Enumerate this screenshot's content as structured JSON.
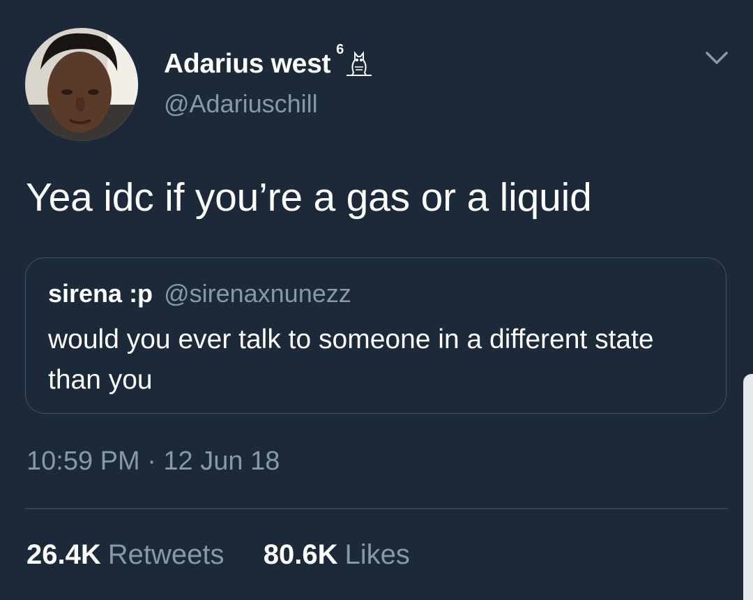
{
  "tweet": {
    "author": {
      "display_name": "Adarius west",
      "name_emoji_number": "6",
      "name_emoji_icon": "owl-icon",
      "handle": "@Adariuschill",
      "avatar_icon": "profile-avatar"
    },
    "menu_icon": "chevron-down-icon",
    "text": "Yea idc if you’re a gas or a liquid",
    "quoted": {
      "display_name": "sirena :p",
      "handle": "@sirenaxnunezz",
      "text": "would you ever talk to someone in a different state than you"
    },
    "timestamp": "10:59 PM · 12 Jun 18",
    "stats": {
      "retweets_count": "26.4K",
      "retweets_label": "Retweets",
      "likes_count": "80.6K",
      "likes_label": "Likes"
    }
  },
  "colors": {
    "background": "#1c2938",
    "primary_text": "#ffffff",
    "secondary_text": "#8899a6",
    "border": "#3d5466"
  }
}
